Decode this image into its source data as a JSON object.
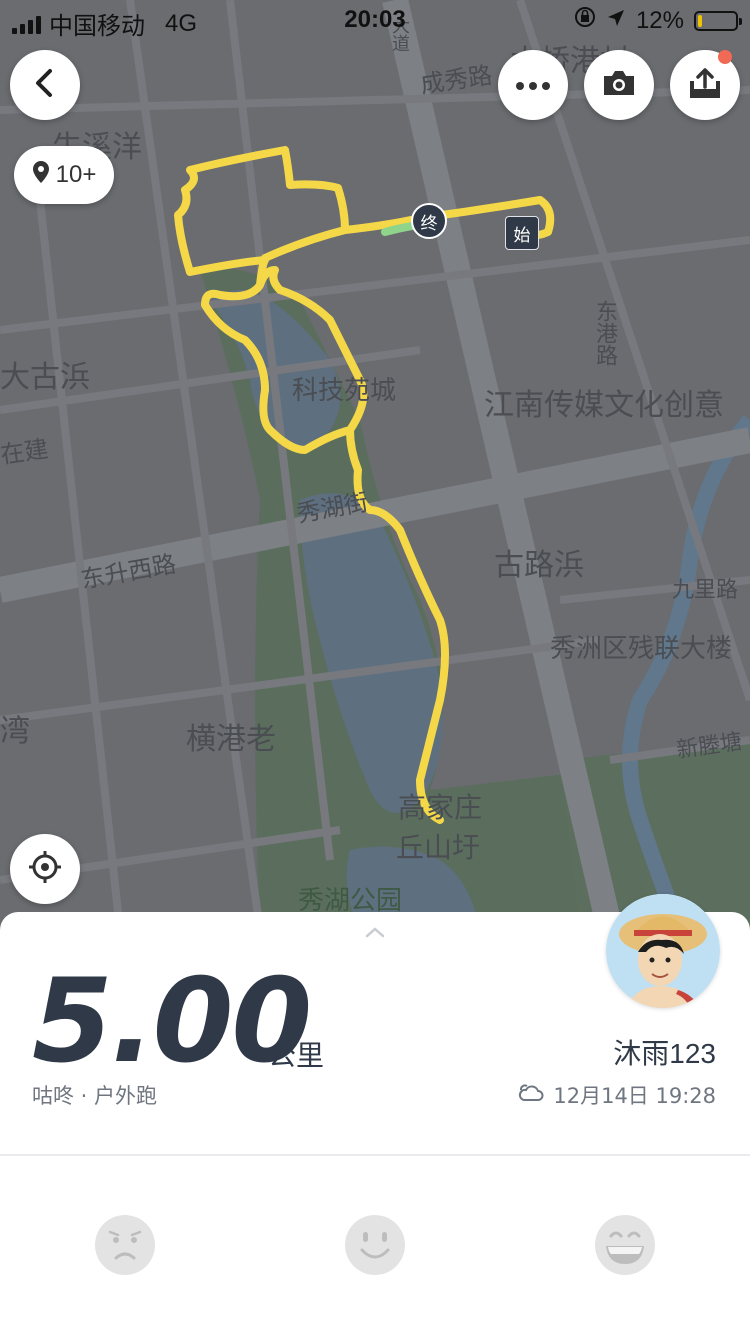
{
  "status_bar": {
    "carrier": "中国移动",
    "network": "4G",
    "time": "20:03",
    "battery_percent": "12%",
    "battery_level": 0.12,
    "battery_color": "#f2c400"
  },
  "map": {
    "photo_count": "10+",
    "start_marker": "始",
    "end_marker": "终",
    "route_color": "#f5d848",
    "labels": {
      "l1": "成秀路",
      "l2": "木桥港村",
      "l3": "牛溪洋",
      "l4": "大古浜",
      "l5": "在建",
      "l6": "科技苑城",
      "l7": "江南传媒文化创意",
      "l8": "东港路",
      "l9": "秀湖街",
      "l10": "东升西路",
      "l11": "古路浜",
      "l12": "九里路",
      "l13": "秀洲区残联大楼",
      "l14": "新塍塘",
      "l15": "横港老",
      "l16": "湾",
      "l17": "高家庄",
      "l18": "丘山圩",
      "l19": "秀湖公园",
      "l20": "大道"
    }
  },
  "toolbar": {
    "back_icon": "chevron-left-icon",
    "more_icon": "more-dots-icon",
    "camera_icon": "camera-icon",
    "share_icon": "share-icon",
    "locate_icon": "locate-target-icon"
  },
  "summary": {
    "distance": "5.00",
    "unit": "公里",
    "source": "咕咚 · 户外跑",
    "username": "沐雨123",
    "datetime": "12月14日 19:28",
    "weather_icon": "cloudy-icon"
  },
  "ratings": [
    {
      "name": "sad-face-icon"
    },
    {
      "name": "smile-face-icon"
    },
    {
      "name": "laugh-face-icon"
    }
  ],
  "colors": {
    "primary_text": "#2f3947",
    "secondary_text": "#6f7680",
    "notification_dot": "#f06a55"
  }
}
